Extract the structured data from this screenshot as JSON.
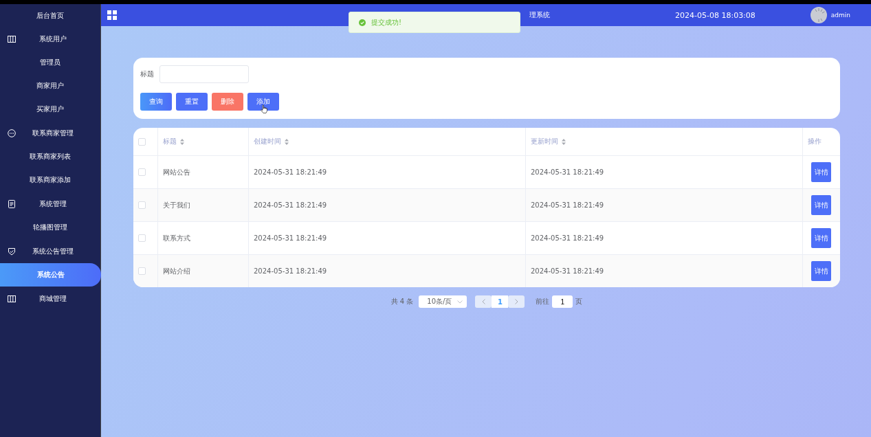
{
  "header": {
    "title": "理系统",
    "datetime": "2024-05-08 18:03:08",
    "user": "admin"
  },
  "toast": {
    "message": "提交成功!",
    "kind": "success"
  },
  "sidebar": {
    "items": [
      {
        "label": "后台首页",
        "selected": false
      },
      {
        "label": "系统用户",
        "selected": false,
        "children": [
          {
            "label": "管理员",
            "selected": false
          },
          {
            "label": "商家用户",
            "selected": false
          },
          {
            "label": "买家用户",
            "selected": false
          }
        ]
      },
      {
        "label": "联系商家管理",
        "selected": false,
        "children": [
          {
            "label": "联系商家列表",
            "selected": false
          },
          {
            "label": "联系商家添加",
            "selected": false
          }
        ]
      },
      {
        "label": "系统管理",
        "selected": false,
        "children": [
          {
            "label": "轮播图管理",
            "selected": false
          }
        ]
      },
      {
        "label": "系统公告管理",
        "selected": false,
        "children": [
          {
            "label": "系统公告",
            "selected": true
          }
        ]
      },
      {
        "label": "商城管理",
        "selected": false
      }
    ]
  },
  "search": {
    "label": "标题",
    "buttons": [
      {
        "label": "查询",
        "kind": "query"
      },
      {
        "label": "重置",
        "kind": "reset"
      },
      {
        "label": "删除",
        "kind": "delete"
      },
      {
        "label": "添加",
        "kind": "add"
      }
    ]
  },
  "table": {
    "all_checked": false,
    "columns": [
      "标题",
      "创建时间",
      "更新时间",
      "操作"
    ],
    "rows": [
      {
        "checked": false,
        "title": "网站公告",
        "created": "2024-05-31 18:21:49",
        "updated": "2024-05-31 18:21:49",
        "action": "详情"
      },
      {
        "checked": false,
        "title": "关于我们",
        "created": "2024-05-31 18:21:49",
        "updated": "2024-05-31 18:21:49",
        "action": "详情"
      },
      {
        "checked": false,
        "title": "联系方式",
        "created": "2024-05-31 18:21:49",
        "updated": "2024-05-31 18:21:49",
        "action": "详情"
      },
      {
        "checked": false,
        "title": "网站介绍",
        "created": "2024-05-31 18:21:49",
        "updated": "2024-05-31 18:21:49",
        "action": "详情"
      }
    ]
  },
  "pagination": {
    "total": "共 4 条",
    "page_size": "10条/页",
    "pages": [
      {
        "label": "1",
        "selected": true
      }
    ],
    "goto_label": "前往",
    "goto_value": "1",
    "goto_suffix": "页"
  }
}
